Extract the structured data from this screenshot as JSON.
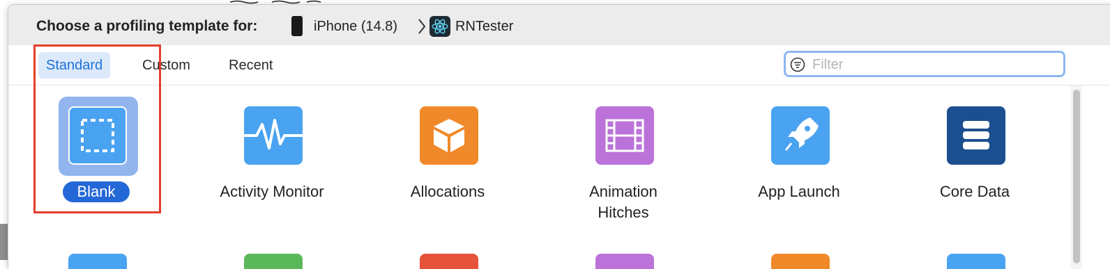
{
  "header": {
    "title": "Choose a profiling template for:",
    "device": "iPhone (14.8)",
    "app": "RNTester"
  },
  "tabs": [
    {
      "label": "Standard",
      "selected": true
    },
    {
      "label": "Custom",
      "selected": false
    },
    {
      "label": "Recent",
      "selected": false
    }
  ],
  "filter": {
    "placeholder": "Filter",
    "value": ""
  },
  "templates": [
    {
      "label": "Blank",
      "icon": "blank-template-icon",
      "color": "#4aa3f0",
      "selected": true
    },
    {
      "label": "Activity Monitor",
      "icon": "heartbeat-icon",
      "color": "#4aa3f0",
      "selected": false
    },
    {
      "label": "Allocations",
      "icon": "cube-icon",
      "color": "#f0892a",
      "selected": false
    },
    {
      "label": "Animation\nHitches",
      "icon": "film-strip-icon",
      "color": "#bb73d9",
      "selected": false
    },
    {
      "label": "App Launch",
      "icon": "rocket-icon",
      "color": "#4aa3f0",
      "selected": false
    },
    {
      "label": "Core Data",
      "icon": "database-icon",
      "color": "#1c4f8f",
      "selected": false
    }
  ],
  "row2_colors": [
    "#4aa3f0",
    "#5bb85a",
    "#e5533a",
    "#bb73d9",
    "#f0892a",
    "#4aa3f0"
  ],
  "highlight_color": "#e53d2a"
}
